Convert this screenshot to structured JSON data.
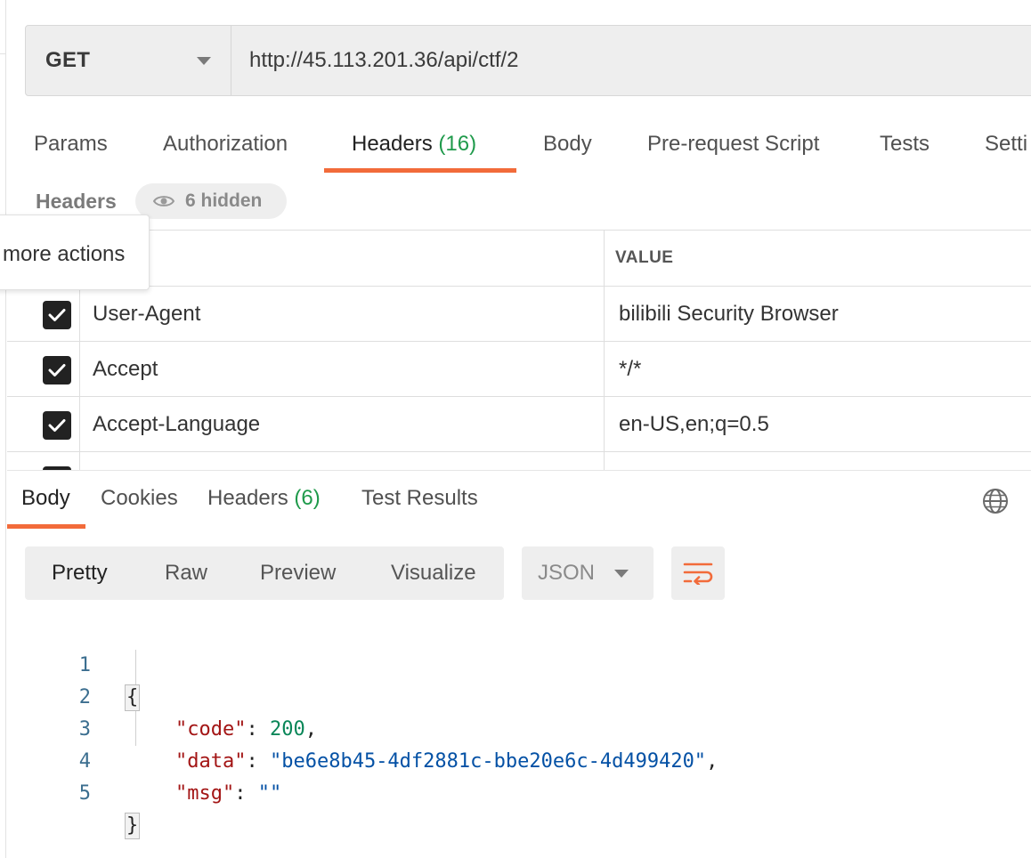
{
  "request": {
    "method": "GET",
    "url": "http://45.113.201.36/api/ctf/2"
  },
  "request_tabs": [
    {
      "label": "Params",
      "count": ""
    },
    {
      "label": "Authorization",
      "count": ""
    },
    {
      "label": "Headers",
      "count": "(16)"
    },
    {
      "label": "Body",
      "count": ""
    },
    {
      "label": "Pre-request Script",
      "count": ""
    },
    {
      "label": "Tests",
      "count": ""
    },
    {
      "label": "Setti",
      "count": ""
    }
  ],
  "headers_section": {
    "title": "Headers",
    "hidden_label": "6 hidden",
    "value_column": "VALUE",
    "tooltip": "more actions",
    "rows": [
      {
        "key": "User-Agent",
        "value": "bilibili Security Browser",
        "checked": true
      },
      {
        "key": "Accept",
        "value": "*/*",
        "checked": true
      },
      {
        "key": "Accept-Language",
        "value": "en-US,en;q=0.5",
        "checked": true
      }
    ]
  },
  "response_tabs": [
    {
      "label": "Body",
      "count": ""
    },
    {
      "label": "Cookies",
      "count": ""
    },
    {
      "label": "Headers",
      "count": "(6)"
    },
    {
      "label": "Test Results",
      "count": ""
    }
  ],
  "view_modes": [
    "Pretty",
    "Raw",
    "Preview",
    "Visualize"
  ],
  "format": "JSON",
  "code": {
    "line_numbers": [
      "1",
      "2",
      "3",
      "4",
      "5"
    ],
    "open_brace": "{",
    "close_brace": "}",
    "fields": [
      {
        "key": "\"code\"",
        "value": "200",
        "type": "number",
        "trail": ","
      },
      {
        "key": "\"data\"",
        "value": "\"be6e8b45-4df2881c-bbe20e6c-4d499420\"",
        "type": "string",
        "trail": ","
      },
      {
        "key": "\"msg\"",
        "value": "\"\"",
        "type": "string",
        "trail": ""
      }
    ]
  },
  "colors": {
    "accent": "#f26b3a",
    "count_green": "#1f9a4b",
    "json_key": "#a31515",
    "json_number": "#098658",
    "json_string": "#0451a5"
  },
  "icons": {
    "method_dropdown": "chevron-down-icon",
    "hidden": "eye-icon",
    "checkbox": "checkmark-icon",
    "network": "globe-icon",
    "wrap": "wrap-lines-icon"
  }
}
